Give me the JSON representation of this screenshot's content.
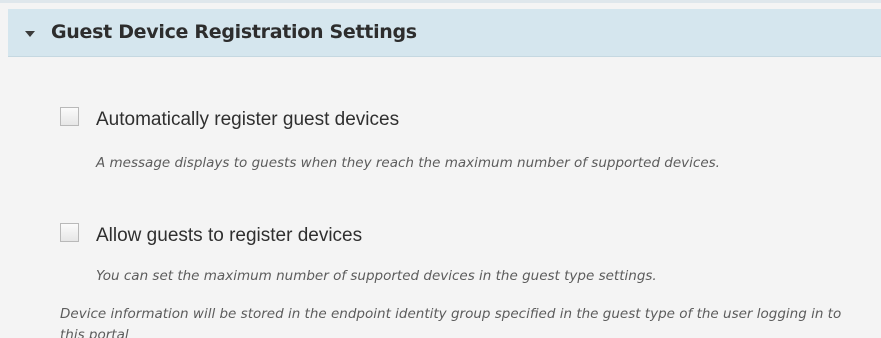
{
  "section": {
    "title": "Guest Device Registration Settings",
    "caret_icon": "caret-down-icon",
    "expanded": true
  },
  "options": [
    {
      "label": "Automatically register guest devices",
      "checked": false,
      "help": "A message displays to guests when they reach the maximum number of supported devices."
    },
    {
      "label": "Allow guests to register devices",
      "checked": false,
      "help": "You can set the maximum number of supported devices in the guest type settings."
    }
  ],
  "footer_note": "Device information will be stored in the endpoint identity group specified in the guest type of the user logging in to this portal",
  "colors": {
    "header_bg": "#d5e6ee",
    "panel_bg": "#f4f4f4",
    "help_text": "#5c5c5c"
  }
}
